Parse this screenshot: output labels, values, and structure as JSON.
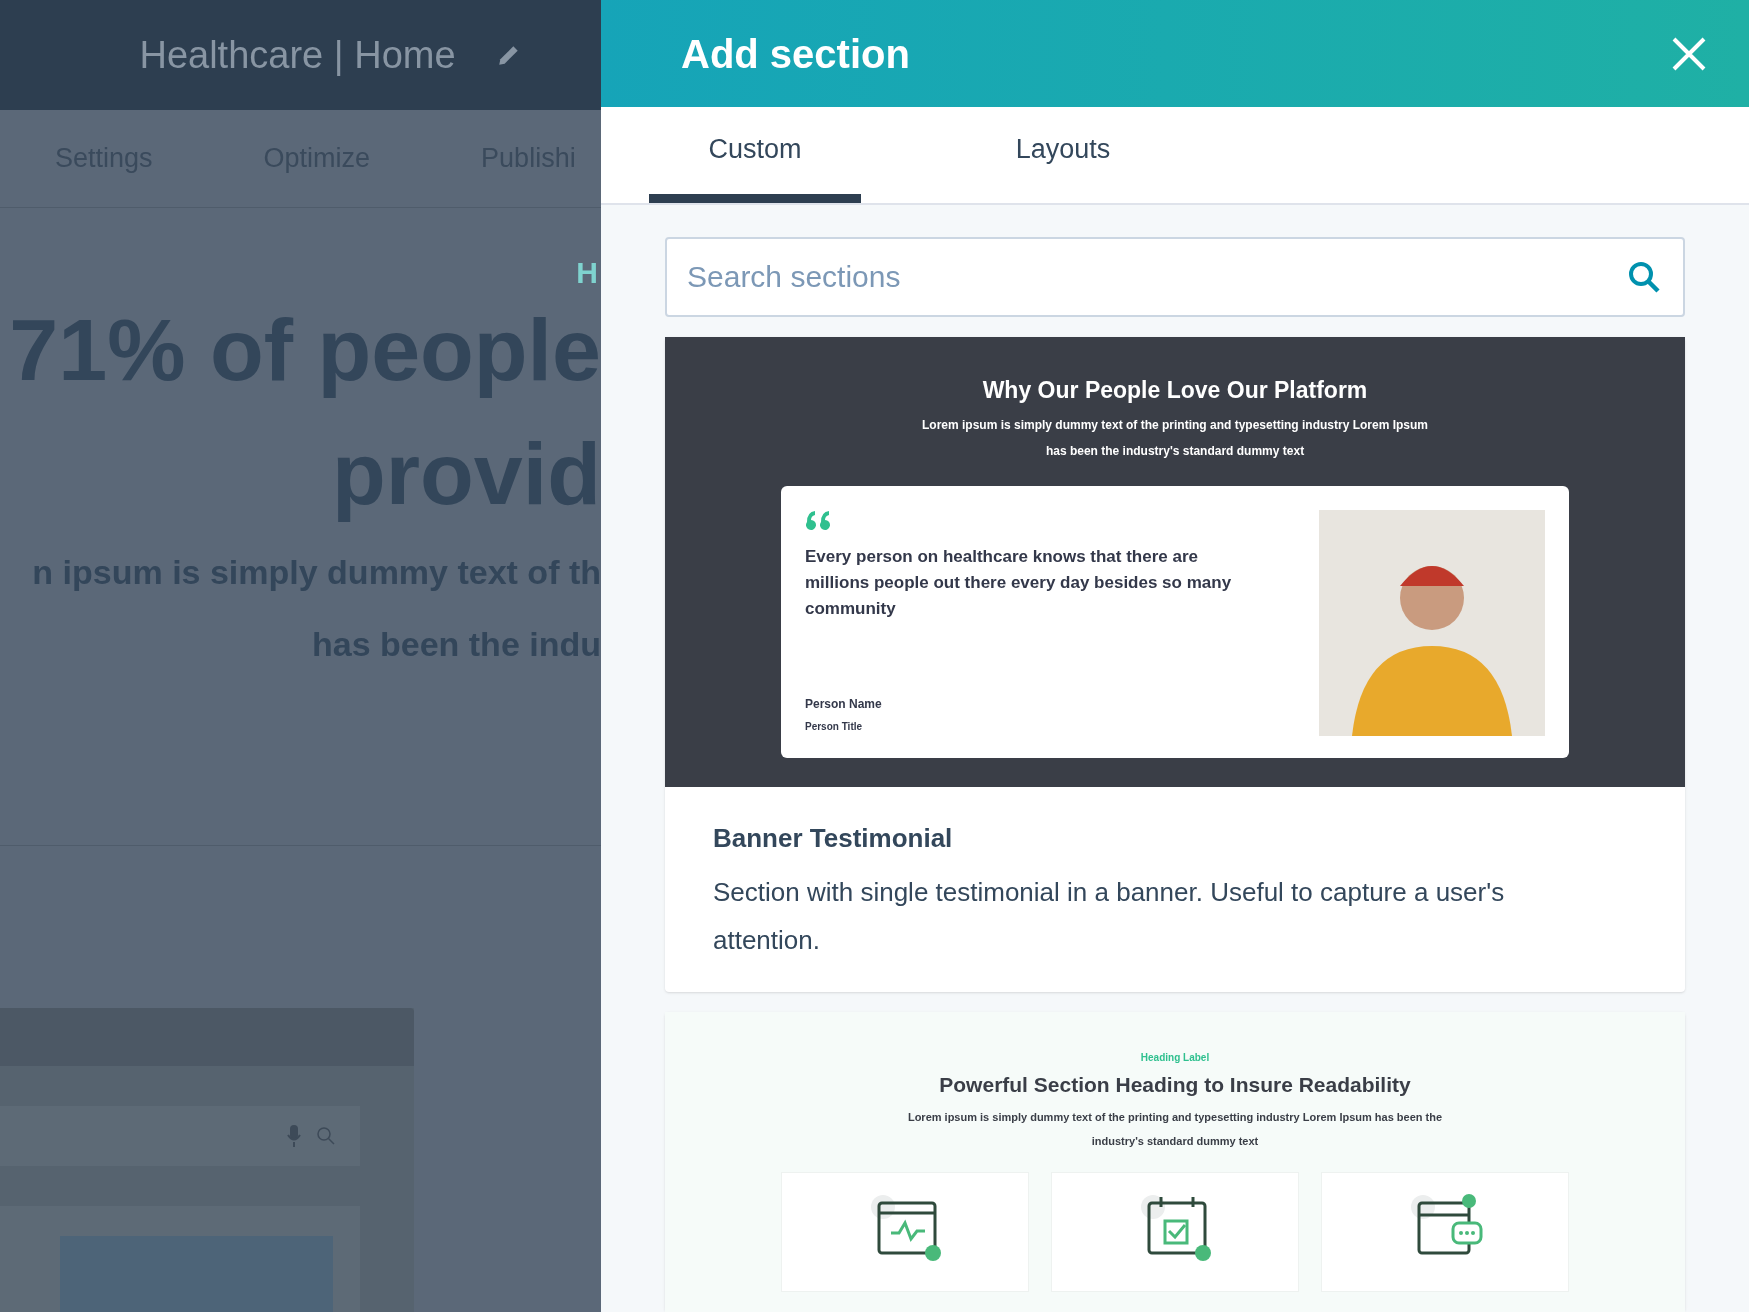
{
  "background_page": {
    "title": "Healthcare | Home",
    "nav": [
      "Settings",
      "Optimize",
      "Publishi"
    ],
    "hero_label": "H",
    "headline": [
      "71% of people",
      "provid"
    ],
    "subtitle": [
      "n ipsum is simply dummy text of th",
      "has been the indu"
    ]
  },
  "panel": {
    "title": "Add section",
    "tabs": [
      {
        "label": "Custom",
        "selected": true
      },
      {
        "label": "Layouts",
        "selected": false
      }
    ],
    "search": {
      "placeholder": "Search sections"
    },
    "sections": [
      {
        "kind": "testimonial",
        "preview": {
          "heading": "Why Our People Love Our Platform",
          "text": [
            "Lorem ipsum is simply dummy text of the printing and typesetting industry Lorem Ipsum",
            "has been the industry's standard dummy text"
          ],
          "quote": "Every person on healthcare knows that there are millions people out there every day besides so many community",
          "person_name": "Person Name",
          "person_title": "Person Title"
        },
        "name": "Banner Testimonial",
        "description": "Section with single testimonial in a banner. Useful to capture a user's attention."
      },
      {
        "kind": "features",
        "preview": {
          "label": "Heading Label",
          "heading": "Powerful Section Heading to Insure Readability",
          "text": [
            "Lorem ipsum is simply dummy text of the printing and typesetting industry Lorem Ipsum has been the",
            "industry's standard dummy text"
          ]
        }
      }
    ]
  }
}
